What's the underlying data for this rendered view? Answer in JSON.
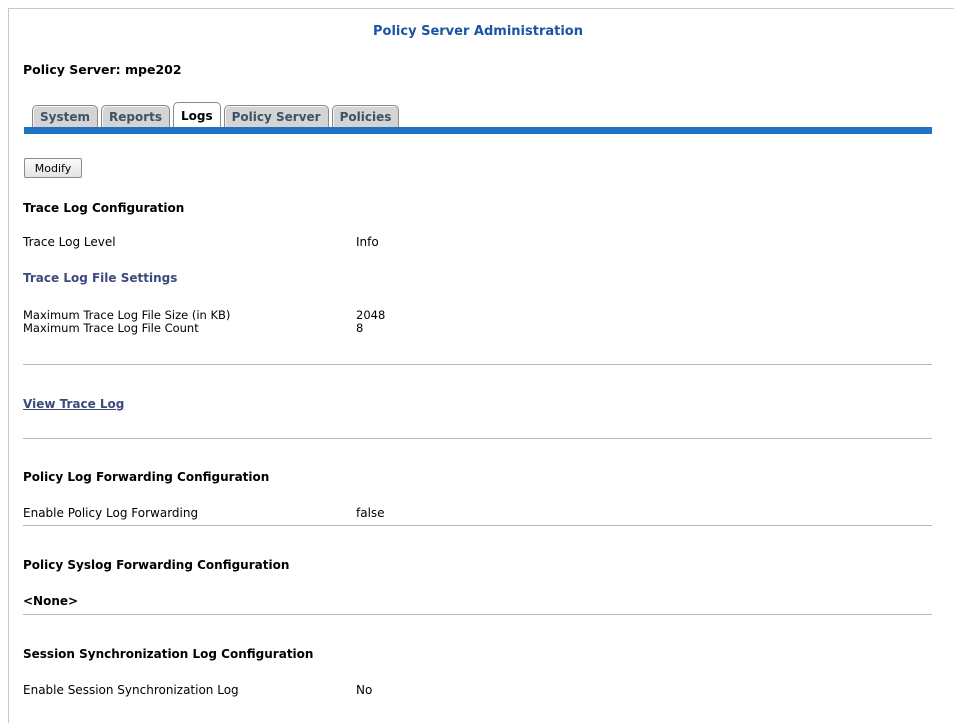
{
  "header": {
    "title": "Policy Server Administration",
    "server_line": "Policy Server: mpe202"
  },
  "tabs": [
    {
      "label": "System",
      "active": false
    },
    {
      "label": "Reports",
      "active": false
    },
    {
      "label": "Logs",
      "active": true
    },
    {
      "label": "Policy Server",
      "active": false
    },
    {
      "label": "Policies",
      "active": false
    }
  ],
  "toolbar": {
    "modify_label": "Modify"
  },
  "trace_log": {
    "heading": "Trace Log Configuration",
    "level_label": "Trace Log Level",
    "level_value": "Info",
    "file_settings_heading": "Trace Log File Settings",
    "max_size_label": "Maximum Trace Log File Size (in KB)",
    "max_size_value": "2048",
    "max_count_label": "Maximum Trace Log File Count",
    "max_count_value": "8"
  },
  "view_trace_log": "View Trace Log",
  "policy_log_forwarding": {
    "heading": "Policy Log Forwarding Configuration",
    "enable_label": "Enable Policy Log Forwarding",
    "enable_value": "false"
  },
  "policy_syslog_forwarding": {
    "heading": "Policy Syslog Forwarding Configuration",
    "value": "<None>"
  },
  "session_sync_log": {
    "heading": "Session Synchronization Log Configuration",
    "enable_label": "Enable Session Synchronization Log",
    "enable_value": "No"
  },
  "colors": {
    "title": "#1a54a4",
    "tab_bar": "#1f73c2",
    "subheading": "#3c4a7e"
  }
}
